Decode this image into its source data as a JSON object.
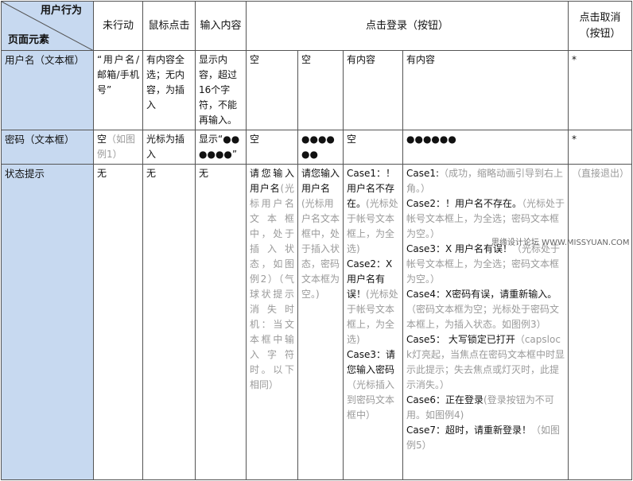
{
  "corner": {
    "top": "用户行为",
    "bottom": "页面元素"
  },
  "headers": [
    "未行动",
    "鼠标点击",
    "输入内容",
    "点击登录（按钮）",
    "点击取消（按钮）"
  ],
  "row_labels": [
    "用户名（文本框）",
    "密码（文本框）",
    "状态提示"
  ],
  "username": {
    "c1": "“用户名/邮箱/手机号”",
    "c2": "有内容全选；无内容，为插入",
    "c3": "显示内容，超过16个字符，不能再输入。",
    "c4": "空",
    "c5": "空",
    "c6": "有内容",
    "c7": "有内容",
    "c8": "*"
  },
  "password": {
    "c1_main": "空",
    "c1_note": "（如图例1）",
    "c2": "光标为插入",
    "c3": "显示“●●●●●●”",
    "c4": "空",
    "c5": "●●●●●●",
    "c6": "空",
    "c7": "●●●●●●",
    "c8": "*"
  },
  "status": {
    "c1": "无",
    "c2": "无",
    "c3": "无",
    "c4_main": "请您输入用户名",
    "c4_note": "(光标用户名文本框中，处于插入状态，如图例2）（气球状提示消失时机：当文本框中输入字符时。以下相同）",
    "c5_main": "请您输入用户名",
    "c5_note": "(光标用户名文本框中，处于插入状态，密码文本框为空。)",
    "c6": [
      {
        "main": "Case1：！用户名不存在。",
        "note": "(光标处于帐号文本框上，为全选)"
      },
      {
        "main": "Case2：X用户名有误！",
        "note": "(光标处于帐号文本框上，为全选)"
      },
      {
        "main": "Case3：请您输入密码",
        "note": "（光标插入到密码文本框中）"
      }
    ],
    "c7": [
      {
        "main": "Case1:",
        "note": "（成功，缩略动画引导到右上角。）"
      },
      {
        "main": "Case2：！用户名不存在。",
        "note": "（光标处于帐号文本框上，为全选；密码文本框为空。）"
      },
      {
        "main": "Case3：X 用户名有误！",
        "note": "（光标处于帐号文本框上，为全选；密码文本框为空。）"
      },
      {
        "main": "Case4：X密码有误，请重新输入。",
        "note": "（密码文本框为空；光标处于密码文本框上，为插入状态。如图例3）"
      },
      {
        "main": "Case5：  大写锁定已打开",
        "note": "（capslock灯亮起，当焦点在密码文本框中时显示此提示；失去焦点或灯灭时，此提示消失。）"
      },
      {
        "main": "Case6：正在登录",
        "note": "(登录按钮为不可用。如图例4)"
      },
      {
        "main": "Case7：超时，请重新登录！",
        "note": "（如图例5）"
      }
    ],
    "c8": "（直接退出）"
  },
  "watermark": "思缘设计论坛 WWW.MISSYUAN.COM"
}
